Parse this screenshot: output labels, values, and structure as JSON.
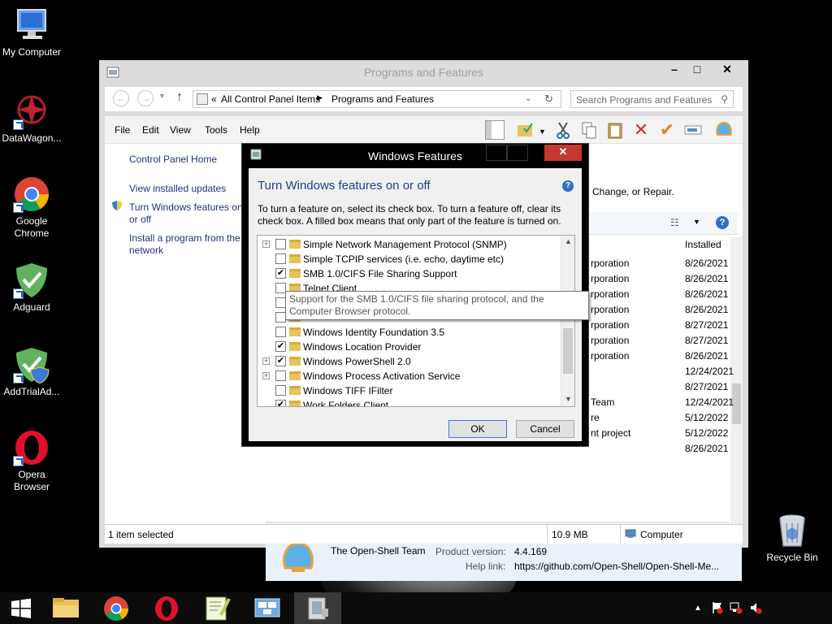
{
  "desktop": {
    "icons": [
      {
        "label": "My Computer"
      },
      {
        "label": "DataWagon..."
      },
      {
        "label": "Google Chrome"
      },
      {
        "label": "Adguard"
      },
      {
        "label": "AddTrialAd..."
      },
      {
        "label": "Opera Browser"
      },
      {
        "label": "Recycle Bin"
      }
    ]
  },
  "window": {
    "title": "Programs and Features",
    "breadcrumb": [
      "All Control Panel Items",
      "Programs and Features"
    ],
    "breadcrumb_prefix": "«",
    "search_placeholder": "Search Programs and Features",
    "menu": [
      "File",
      "Edit",
      "View",
      "Tools",
      "Help"
    ],
    "nav": {
      "home": "Control Panel Home",
      "updates": "View installed updates",
      "features": "Turn Windows features on or off",
      "install": "Install a program from the network"
    },
    "behind_text": "Change, or Repair.",
    "list": {
      "installed_header": "Installed",
      "rows": [
        {
          "publisher": "rporation",
          "date": "8/26/2021"
        },
        {
          "publisher": "rporation",
          "date": "8/26/2021"
        },
        {
          "publisher": "rporation",
          "date": "8/26/2021"
        },
        {
          "publisher": "rporation",
          "date": "8/26/2021"
        },
        {
          "publisher": "rporation",
          "date": "8/27/2021"
        },
        {
          "publisher": "rporation",
          "date": "8/27/2021"
        },
        {
          "publisher": "rporation",
          "date": "8/26/2021"
        },
        {
          "publisher": "",
          "date": "12/24/2021"
        },
        {
          "publisher": "",
          "date": "8/27/2021"
        },
        {
          "publisher": "Team",
          "date": "12/24/2021"
        },
        {
          "publisher": "re",
          "date": "5/12/2022"
        },
        {
          "publisher": "nt project",
          "date": "5/12/2022"
        },
        {
          "publisher": "",
          "date": "8/26/2021"
        }
      ]
    },
    "details": {
      "publisher": "The Open-Shell Team",
      "version_label": "Product version:",
      "version": "4.4.169",
      "help_label": "Help link:",
      "help_link": "https://github.com/Open-Shell/Open-Shell-Me..."
    },
    "status": {
      "selected": "1 item selected",
      "size": "10.9 MB",
      "location": "Computer"
    }
  },
  "dialog": {
    "title": "Windows Features",
    "heading": "Turn Windows features on or off",
    "description": "To turn a feature on, select its check box. To turn a feature off, clear its check box. A filled box means that only part of the feature is turned on.",
    "features": [
      {
        "name": "Simple Network Management Protocol (SNMP)",
        "expandable": true,
        "checked": false
      },
      {
        "name": "Simple TCPIP services (i.e. echo, daytime etc)",
        "expandable": false,
        "checked": false
      },
      {
        "name": "SMB 1.0/CIFS File Sharing Support",
        "expandable": false,
        "checked": true
      },
      {
        "name": "Telnet Client",
        "expandable": false,
        "checked": false
      },
      {
        "name": "",
        "expandable": false,
        "checked": false
      },
      {
        "name": "",
        "expandable": false,
        "checked": false
      },
      {
        "name": "Windows Identity Foundation 3.5",
        "expandable": false,
        "checked": false
      },
      {
        "name": "Windows Location Provider",
        "expandable": false,
        "checked": true
      },
      {
        "name": "Windows PowerShell 2.0",
        "expandable": true,
        "checked": true
      },
      {
        "name": "Windows Process Activation Service",
        "expandable": true,
        "checked": false
      },
      {
        "name": "Windows TIFF IFilter",
        "expandable": false,
        "checked": false
      },
      {
        "name": "Work Folders Client",
        "expandable": false,
        "checked": true
      }
    ],
    "tooltip": "Support for the SMB 1.0/CIFS file sharing protocol, and the Computer Browser protocol.",
    "ok": "OK",
    "cancel": "Cancel"
  },
  "colors": {
    "link": "#1e3287",
    "dialog_heading": "#1e3f8c",
    "close_red": "#c7372b"
  }
}
